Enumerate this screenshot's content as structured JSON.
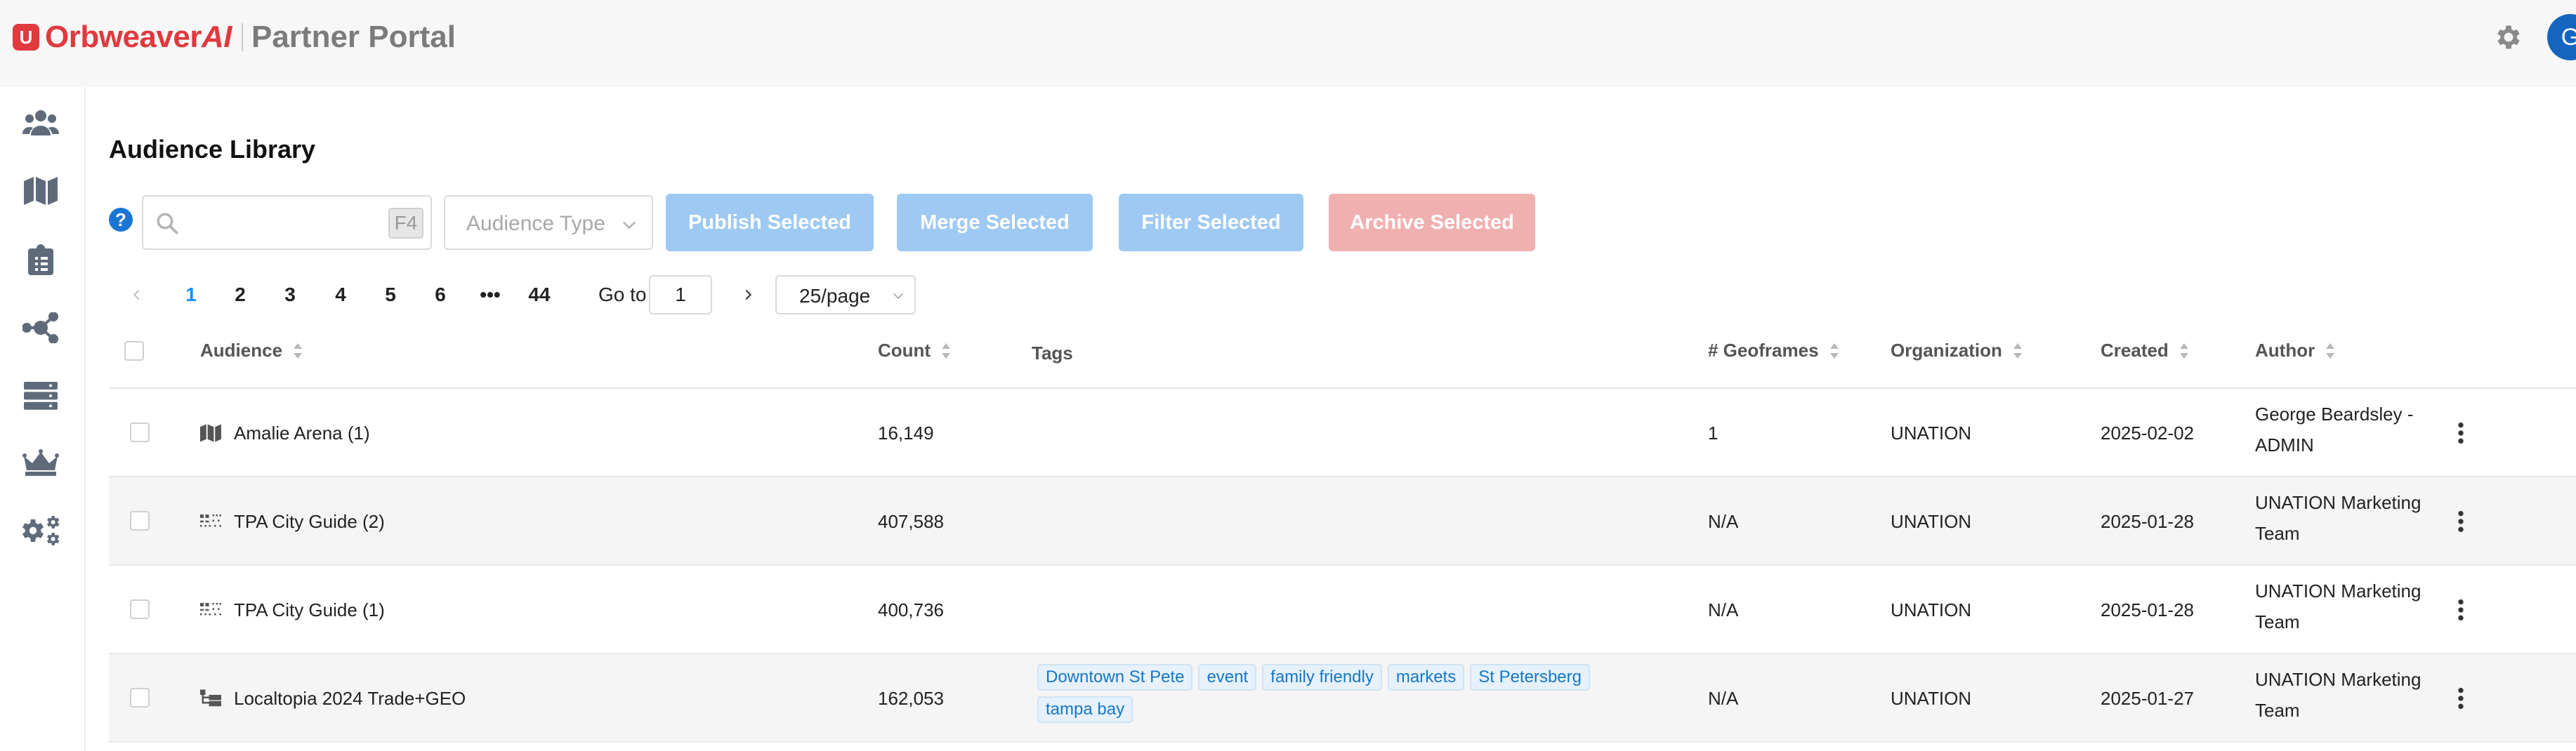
{
  "header": {
    "logo_mark": "U",
    "brand": "Orbweaver",
    "brand_suffix": "AI",
    "portal_title": "Partner Portal",
    "avatar_initial": "G",
    "accent_color": "#e0393e"
  },
  "sidebar": {
    "items": [
      {
        "icon": "users-icon"
      },
      {
        "icon": "map-icon"
      },
      {
        "icon": "clipboard-icon"
      },
      {
        "icon": "network-icon"
      },
      {
        "icon": "server-icon"
      },
      {
        "icon": "crown-icon"
      },
      {
        "icon": "cogs-icon"
      }
    ]
  },
  "page": {
    "title": "Audience Library"
  },
  "toolbar": {
    "search_value": "",
    "search_shortcut": "F4",
    "audience_type_placeholder": "Audience Type",
    "publish_label": "Publish Selected",
    "merge_label": "Merge Selected",
    "filter_label": "Filter Selected",
    "archive_label": "Archive Selected"
  },
  "pagination": {
    "pages": [
      "1",
      "2",
      "3",
      "4",
      "5",
      "6",
      "•••",
      "44"
    ],
    "current": "1",
    "goto_label": "Go to",
    "goto_value": "1",
    "page_size": "25/page"
  },
  "table": {
    "headers": {
      "audience": "Audience",
      "count": "Count",
      "tags": "Tags",
      "geoframes": "# Geoframes",
      "organization": "Organization",
      "created": "Created",
      "author": "Author"
    },
    "rows": [
      {
        "icon": "map-icon",
        "audience": "Amalie Arena (1)",
        "count": "16,149",
        "tags": [],
        "geoframes": "1",
        "organization": "UNATION",
        "created": "2025-02-02",
        "author_line1": "George Beardsley -",
        "author_line2": "ADMIN"
      },
      {
        "icon": "dots-grid-icon",
        "audience": "TPA City Guide (2)",
        "count": "407,588",
        "tags": [],
        "geoframes": "N/A",
        "organization": "UNATION",
        "created": "2025-01-28",
        "author_line1": "UNATION Marketing",
        "author_line2": "Team"
      },
      {
        "icon": "dots-grid-icon",
        "audience": "TPA City Guide (1)",
        "count": "400,736",
        "tags": [],
        "geoframes": "N/A",
        "organization": "UNATION",
        "created": "2025-01-28",
        "author_line1": "UNATION Marketing",
        "author_line2": "Team"
      },
      {
        "icon": "tree-icon",
        "audience": "Localtopia 2024 Trade+GEO",
        "count": "162,053",
        "tags": [
          "Downtown St Pete",
          "event",
          "family friendly",
          "markets",
          "St Petersberg",
          "tampa bay"
        ],
        "geoframes": "N/A",
        "organization": "UNATION",
        "created": "2025-01-27",
        "author_line1": "UNATION Marketing",
        "author_line2": "Team"
      }
    ]
  }
}
